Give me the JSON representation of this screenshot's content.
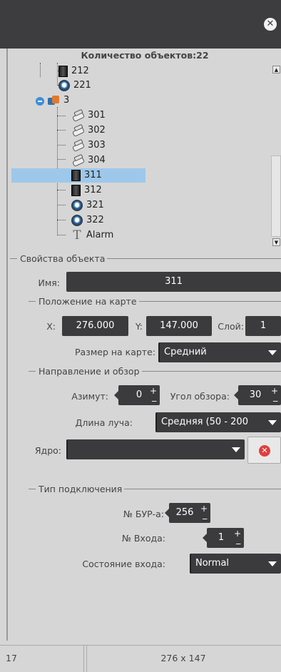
{
  "header": {
    "close_icon": "close-icon"
  },
  "tree": {
    "title": "Количество объектов:22",
    "items": [
      {
        "label": "212",
        "icon": "block-icon"
      },
      {
        "label": "221",
        "icon": "camera-icon"
      },
      {
        "label": "3",
        "icon": "group-icon"
      },
      {
        "label": "301",
        "icon": "pipe-icon"
      },
      {
        "label": "302",
        "icon": "pipe-icon"
      },
      {
        "label": "303",
        "icon": "pipe-icon"
      },
      {
        "label": "304",
        "icon": "pipe-icon"
      },
      {
        "label": "311",
        "icon": "block-icon",
        "selected": true
      },
      {
        "label": "312",
        "icon": "block-icon"
      },
      {
        "label": "321",
        "icon": "camera-icon"
      },
      {
        "label": "322",
        "icon": "camera-icon"
      },
      {
        "label": "Alarm",
        "icon": "text-icon"
      }
    ],
    "selection_color": "#9ec8ea"
  },
  "props": {
    "legend": "Свойства объекта",
    "name_label": "Имя:",
    "name_value": "311",
    "position": {
      "legend": "Положение на карте",
      "x_label": "X:",
      "x_value": "276.000",
      "y_label": "Y:",
      "y_value": "147.000",
      "layer_label": "Слой:",
      "layer_value": "1",
      "size_label": "Размер на карте:",
      "size_value": "Средний"
    },
    "direction": {
      "legend": "Направление и обзор",
      "azimuth_label": "Азимут:",
      "azimuth_value": "0",
      "view_angle_label": "Угол обзора:",
      "view_angle_value": "30",
      "beam_label": "Длина луча:",
      "beam_value": "Средняя (50 - 200"
    },
    "core_label": "Ядро:",
    "core_value": "",
    "connection": {
      "legend": "Тип подключения",
      "bur_label": "№ БУР-а:",
      "bur_value": "256",
      "input_label": "№ Входа:",
      "input_value": "1",
      "state_label": "Состояние входа:",
      "state_value": "Normal"
    }
  },
  "status": {
    "left": "17",
    "right": "276 x 147"
  },
  "colors": {
    "header_bg": "#3d3d3f",
    "panel_bg": "#d6d6d6",
    "field_bg": "#3b3b3d",
    "clear_icon": "#e23d3d"
  }
}
